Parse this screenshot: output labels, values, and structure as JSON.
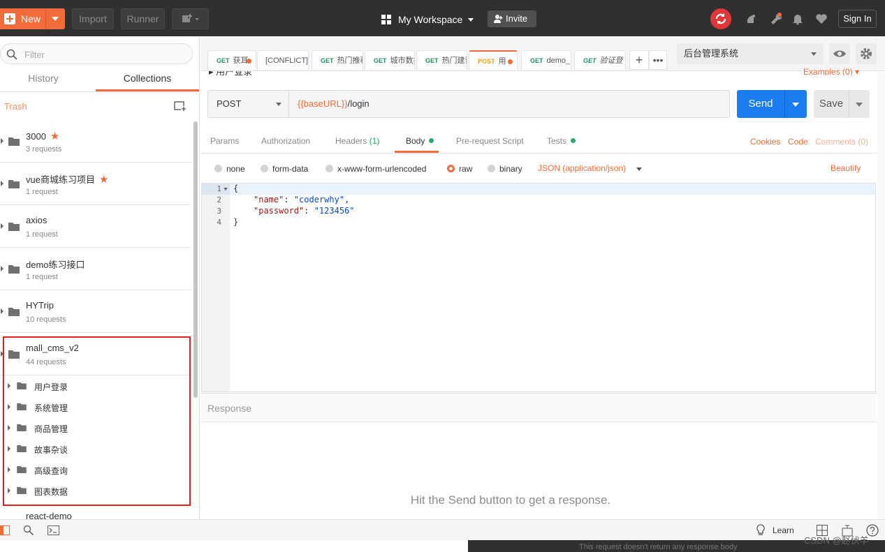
{
  "topbar": {
    "new_label": "New",
    "import_label": "Import",
    "runner_label": "Runner",
    "workspace_label": "My Workspace",
    "invite_label": "Invite",
    "signin_label": "Sign In"
  },
  "sidebar": {
    "filter_placeholder": "Filter",
    "tabs": [
      "History",
      "Collections"
    ],
    "trash_label": "Trash",
    "collections": [
      {
        "name": "3000",
        "count": "3 requests",
        "starred": true
      },
      {
        "name": "vue商城练习项目",
        "count": "1 request",
        "starred": true
      },
      {
        "name": "axios",
        "count": "1 request"
      },
      {
        "name": "demo练习接口",
        "count": "1 request"
      },
      {
        "name": "HYTrip",
        "count": "10 requests"
      },
      {
        "name": "mall_cms_v2",
        "count": "44 requests"
      }
    ],
    "folders": [
      "用户登录",
      "系统管理",
      "商品管理",
      "故事杂谈",
      "高级查询",
      "图表数据"
    ],
    "next_collection": "react-demo"
  },
  "request_tabs": [
    {
      "method": "GET",
      "label": "获耳",
      "dot": true
    },
    {
      "method": "",
      "label": "[CONFLICT]"
    },
    {
      "method": "GET",
      "label": "热门推荐"
    },
    {
      "method": "GET",
      "label": "城市数据"
    },
    {
      "method": "GET",
      "label": "热门建议"
    },
    {
      "method": "POST",
      "label": "用",
      "dot": true,
      "active": true
    },
    {
      "method": "GET",
      "label": "demo_"
    },
    {
      "method": "GET",
      "label": "验证登"
    }
  ],
  "environment": {
    "selected": "后台管理系统"
  },
  "request": {
    "name": "用户登录",
    "examples_label": "Examples (0)",
    "method": "POST",
    "url_var": "{{baseURL}}",
    "url_path": "/login",
    "send_label": "Send",
    "save_label": "Save"
  },
  "req_tabs": {
    "params": "Params",
    "authorization": "Authorization",
    "headers": "Headers",
    "headers_count": "(1)",
    "body": "Body",
    "prerequest": "Pre-request Script",
    "tests": "Tests",
    "cookies": "Cookies",
    "code": "Code",
    "comments": "Comments (0)"
  },
  "body_modes": {
    "none": "none",
    "form_data": "form-data",
    "urlencoded": "x-www-form-urlencoded",
    "raw": "raw",
    "binary": "binary",
    "selected": "raw",
    "content_type": "JSON (application/json)",
    "beautify": "Beautify"
  },
  "editor": {
    "line_numbers": [
      "1",
      "2",
      "3",
      "4"
    ],
    "lines": {
      "l1": "{",
      "l2_key": "\"name\"",
      "l2_colon": ": ",
      "l2_val": "\"coderwhy\"",
      "l2_comma": ",",
      "l3_key": "\"password\"",
      "l3_colon": ": ",
      "l3_val": "\"123456\"",
      "l4": "}"
    }
  },
  "response": {
    "title": "Response",
    "hint": "Hit the Send button to get a response."
  },
  "bottombar": {
    "learn_label": "Learn"
  },
  "below": {
    "text": "This request doesn't return any response body",
    "watermark": "CSDN @赵伏羊"
  },
  "colors": {
    "accent": "#f26b3a",
    "send_blue": "#1a7cf0",
    "dark_bar": "#303030",
    "highlight_red": "#e02020"
  }
}
